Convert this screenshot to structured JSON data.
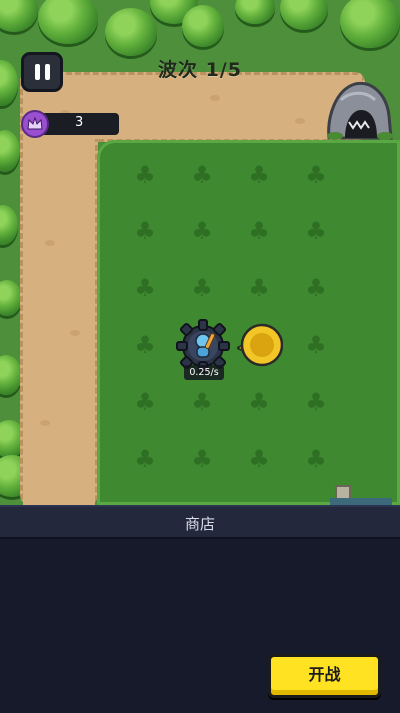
{
  "hud": {
    "wave_text": "波次 1/5",
    "resource_count": "3"
  },
  "tower": {
    "rate": "0.25/s"
  },
  "shop": {
    "title": "商店",
    "start_button": "开战"
  },
  "colors": {
    "path": "#d6b07f",
    "grass": "#3f8a30",
    "panel": "#161a2b",
    "button": "#ffe323"
  }
}
